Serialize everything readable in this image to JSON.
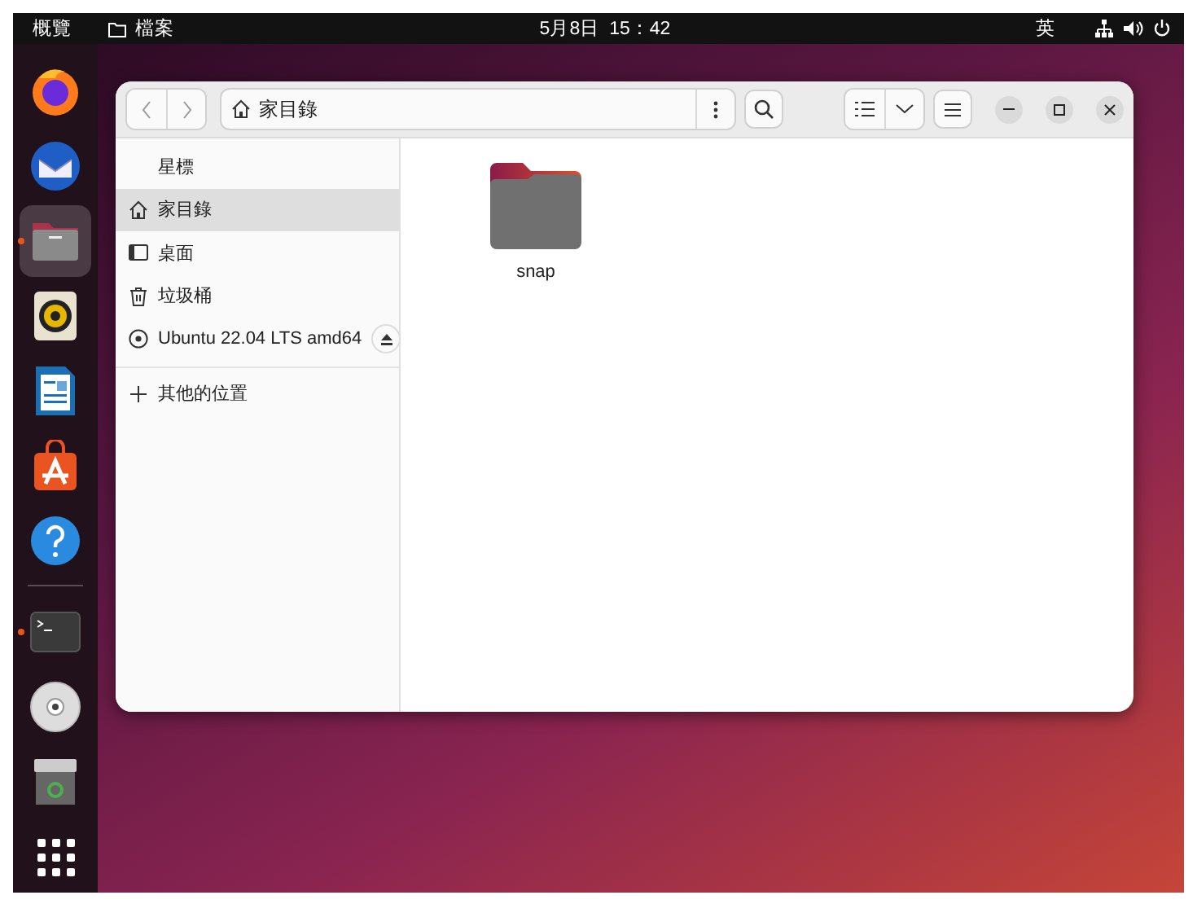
{
  "top_bar": {
    "activities": "概覽",
    "app_menu": "檔案",
    "clock": {
      "date": "5月8日",
      "time": "15：42"
    },
    "input_method": "英"
  },
  "dock": {
    "items": [
      {
        "kind": "browser",
        "running": false,
        "selected": false
      },
      {
        "kind": "mail",
        "running": false,
        "selected": false
      },
      {
        "kind": "files",
        "running": true,
        "selected": true
      },
      {
        "kind": "music",
        "running": false,
        "selected": false
      },
      {
        "kind": "writer",
        "running": false,
        "selected": false
      },
      {
        "kind": "store",
        "running": false,
        "selected": false
      },
      {
        "kind": "help",
        "running": false,
        "selected": false
      },
      {
        "kind": "separator"
      },
      {
        "kind": "terminal",
        "running": true,
        "selected": false
      },
      {
        "kind": "disc",
        "running": false,
        "selected": false
      },
      {
        "kind": "trash",
        "running": false,
        "selected": false
      },
      {
        "kind": "apps",
        "running": false,
        "selected": false
      }
    ]
  },
  "window": {
    "path": "家目錄",
    "sidebar": {
      "items": [
        {
          "kind": "starred",
          "label": "星標",
          "selected": false
        },
        {
          "kind": "home",
          "label": "家目錄",
          "selected": true
        },
        {
          "kind": "desktop",
          "label": "桌面",
          "selected": false
        },
        {
          "kind": "trash",
          "label": "垃圾桶",
          "selected": false
        },
        {
          "kind": "drive",
          "label": "Ubuntu 22.04 LTS amd64",
          "selected": false,
          "ejectable": true
        }
      ],
      "other": {
        "label": "其他的位置"
      }
    },
    "files": [
      {
        "kind": "folder",
        "name": "snap"
      }
    ]
  }
}
